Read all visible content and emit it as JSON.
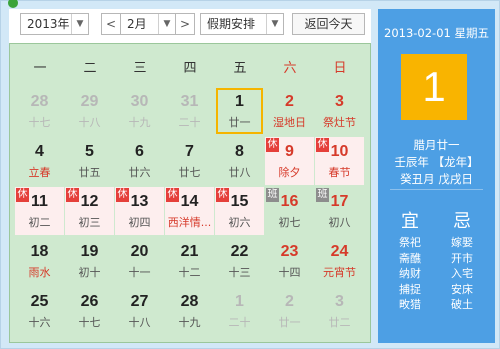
{
  "toolbar": {
    "year": "2013年",
    "prev": "<",
    "month": "2月",
    "next": ">",
    "holiday": "假期安排",
    "today_btn": "返回今天"
  },
  "weekdays": [
    "一",
    "二",
    "三",
    "四",
    "五",
    "六",
    "日"
  ],
  "weeks": [
    [
      {
        "n": "28",
        "s": "十七",
        "other": true
      },
      {
        "n": "29",
        "s": "十八",
        "other": true
      },
      {
        "n": "30",
        "s": "十九",
        "other": true
      },
      {
        "n": "31",
        "s": "二十",
        "other": true
      },
      {
        "n": "1",
        "s": "廿一",
        "today": true
      },
      {
        "n": "2",
        "s": "湿地日",
        "weekend": true,
        "festival": true
      },
      {
        "n": "3",
        "s": "祭灶节",
        "weekend": true,
        "festival": true
      }
    ],
    [
      {
        "n": "4",
        "s": "立春",
        "festival": true
      },
      {
        "n": "5",
        "s": "廿五"
      },
      {
        "n": "6",
        "s": "廿六"
      },
      {
        "n": "7",
        "s": "廿七"
      },
      {
        "n": "8",
        "s": "廿八"
      },
      {
        "n": "9",
        "s": "除夕",
        "weekend": true,
        "festival": true,
        "tag": "休",
        "holiday": true
      },
      {
        "n": "10",
        "s": "春节",
        "weekend": true,
        "festival": true,
        "tag": "休",
        "holiday": true
      }
    ],
    [
      {
        "n": "11",
        "s": "初二",
        "tag": "休",
        "holiday": true
      },
      {
        "n": "12",
        "s": "初三",
        "tag": "休",
        "holiday": true
      },
      {
        "n": "13",
        "s": "初四",
        "tag": "休",
        "holiday": true
      },
      {
        "n": "14",
        "s": "西洋情...",
        "festival": true,
        "tag": "休",
        "holiday": true
      },
      {
        "n": "15",
        "s": "初六",
        "tag": "休",
        "holiday": true
      },
      {
        "n": "16",
        "s": "初七",
        "weekend": true,
        "tag": "班",
        "work": true
      },
      {
        "n": "17",
        "s": "初八",
        "weekend": true,
        "tag": "班",
        "work": true
      }
    ],
    [
      {
        "n": "18",
        "s": "雨水",
        "festival": true
      },
      {
        "n": "19",
        "s": "初十"
      },
      {
        "n": "20",
        "s": "十一"
      },
      {
        "n": "21",
        "s": "十二"
      },
      {
        "n": "22",
        "s": "十三"
      },
      {
        "n": "23",
        "s": "十四",
        "weekend": true
      },
      {
        "n": "24",
        "s": "元宵节",
        "weekend": true,
        "festival": true
      }
    ],
    [
      {
        "n": "25",
        "s": "十六"
      },
      {
        "n": "26",
        "s": "十七"
      },
      {
        "n": "27",
        "s": "十八"
      },
      {
        "n": "28",
        "s": "十九"
      },
      {
        "n": "1",
        "s": "二十",
        "other": true
      },
      {
        "n": "2",
        "s": "廿一",
        "other": true
      },
      {
        "n": "3",
        "s": "廿二",
        "other": true
      }
    ]
  ],
  "side": {
    "date": "2013-02-01 星期五",
    "day": "1",
    "lunar1": "腊月廿一",
    "lunar2": "壬辰年 【龙年】",
    "lunar3": "癸丑月 戊戌日",
    "yi_title": "宜",
    "ji_title": "忌",
    "yi": [
      "祭祀",
      "斋醮",
      "纳财",
      "捕捉",
      "畋猎"
    ],
    "ji": [
      "嫁娶",
      "开市",
      "入宅",
      "安床",
      "破土"
    ]
  },
  "colors": {
    "side_bg": "#4d9fe4",
    "big_day_bg": "#f9b400",
    "grid_bg": "#cfe9cf",
    "holiday_tag": "#e53f3a",
    "work_tag": "#8d8d8d",
    "weekend_text": "#d63a2a"
  }
}
